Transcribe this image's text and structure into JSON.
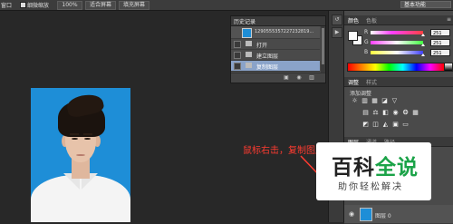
{
  "options_bar": {
    "left_partial_label": "窗口",
    "scrubby_zoom_label": "细微缩放",
    "zoom_button": "100%",
    "fit_screen_button": "适合屏幕",
    "fill_screen_button": "填充屏幕",
    "workspace_label": "基本功能"
  },
  "history_panel": {
    "tab_label": "历史记录",
    "snapshot_label": "1290555357227232819...",
    "items": [
      {
        "label": "打开"
      },
      {
        "label": "建立图层"
      },
      {
        "label": "复制图层"
      }
    ],
    "selected_index": 2
  },
  "color_panel": {
    "tabs": [
      "颜色",
      "色板"
    ],
    "channels": [
      {
        "name": "R",
        "value": "251",
        "gradient_color": "#ff4040"
      },
      {
        "name": "G",
        "value": "251",
        "gradient_color": "#40ff40"
      },
      {
        "name": "B",
        "value": "251",
        "gradient_color": "#4040ff"
      }
    ],
    "foreground_color": "#fbfbfb"
  },
  "adjustments_panel": {
    "tabs": [
      "调整",
      "样式"
    ],
    "add_label": "添加调整"
  },
  "layers_panel": {
    "tabs": [
      "图层",
      "通道",
      "路径"
    ],
    "bottom_layer_label": "图层 0"
  },
  "annotation": {
    "text": "鼠标右击，复制图层",
    "color": "#ff3b30"
  },
  "watermark": {
    "title_part1": "百科",
    "title_part2": "全说",
    "subtitle": "助你轻松解决"
  }
}
